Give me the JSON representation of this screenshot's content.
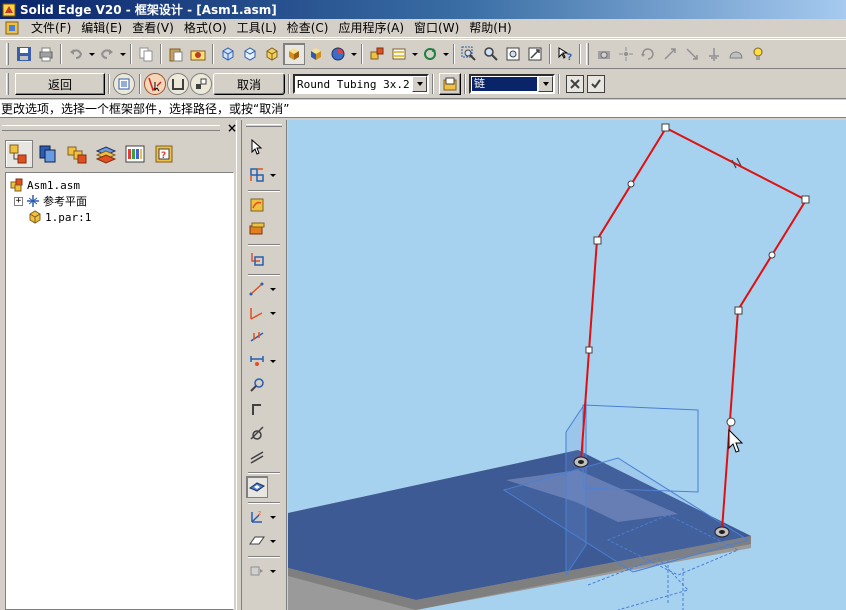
{
  "window": {
    "title": "Solid Edge V20 - 框架设计 - [Asm1.asm]"
  },
  "menu": {
    "items": [
      "文件(F)",
      "编辑(E)",
      "查看(V)",
      "格式(O)",
      "工具(L)",
      "检查(C)",
      "应用程序(A)",
      "窗口(W)",
      "帮助(H)"
    ]
  },
  "command_bar": {
    "back_label": "返回",
    "cancel_label": "取消",
    "profile_value": "Round Tubing 3x.2",
    "selection_value": "链"
  },
  "prompt": {
    "text": "更改选项，选择一个框架部件，选择路径，或按“取消”"
  },
  "pathfinder": {
    "tree": [
      {
        "label": "Asm1.asm"
      },
      {
        "label": "参考平面"
      },
      {
        "label": "1.par:1"
      }
    ]
  },
  "colors": {
    "viewport_bg": "#a6d2f0",
    "frame_path": "#e01010",
    "plate_top": "#3d5a95",
    "plate_edge": "#7f7f7f",
    "reference_plane": "#4a7fd4"
  }
}
